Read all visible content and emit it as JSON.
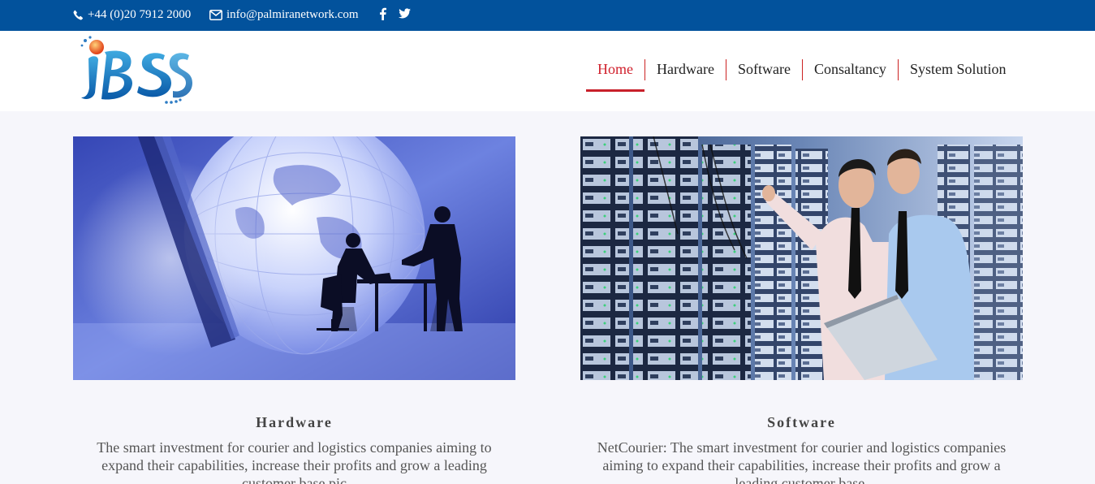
{
  "topbar": {
    "phone": "+44 (0)20 7912 2000",
    "email": "info@palmiranetwork.com",
    "social": [
      "facebook-icon",
      "twitter-icon"
    ]
  },
  "header": {
    "logo_text": "IBS",
    "nav": [
      {
        "label": "Home",
        "active": true
      },
      {
        "label": "Hardware",
        "active": false
      },
      {
        "label": "Software",
        "active": false
      },
      {
        "label": "Consaltancy",
        "active": false
      },
      {
        "label": "System Solution",
        "active": false
      }
    ]
  },
  "cards": [
    {
      "title": "Hardware",
      "text": "The smart investment for courier and logistics companies aiming to expand their capabilities, increase their profits and grow a leading customer base.pic",
      "image": "business-globe-handshake"
    },
    {
      "title": "Software",
      "text": "NetCourier: The smart investment for courier and logistics companies aiming to expand their capabilities, increase their profits and grow a leading customer base.",
      "image": "server-room-engineers"
    }
  ],
  "colors": {
    "topbar": "#02529c",
    "accent": "#d0202c",
    "page_bg": "#f6f6fb"
  }
}
